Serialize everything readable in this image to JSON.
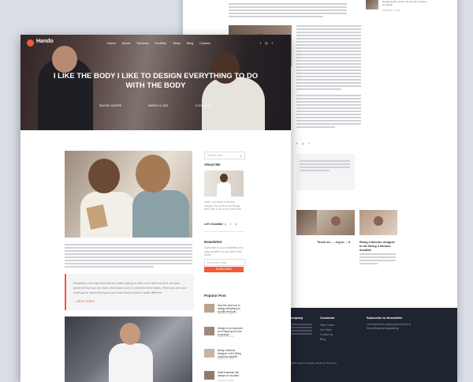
{
  "brand": {
    "name": "Hando",
    "accent": "#f15a3a"
  },
  "nav": {
    "items": [
      "Home",
      "About",
      "Services",
      "Portfolio",
      "Team",
      "Blog",
      "Contact"
    ]
  },
  "hero": {
    "title": "I LIKE THE BODY I LIKE TO DESIGN EVERYTHING TO DO WITH THE BODY",
    "meta": [
      "RACHEL MOORE",
      "MARCH 3, 2021",
      "3 COMMENTS"
    ]
  },
  "sidebar": {
    "search_placeholder": "Search here...",
    "about_title": "About Me",
    "about_text": "Hello, my name is Ashley Harper, my job is to do things that I like to do in my free time.",
    "connect_label": "Let's Socialize",
    "newsletter_title": "Newsletter",
    "newsletter_text": "Subscribe to our newsletter and stay updated on our offers and deals!",
    "email_placeholder": "Enter your email",
    "subscribe_label": "SUBSCRIBE",
    "popular_title": "Popular Post",
    "posts": [
      {
        "title": "How the plus how to design everything to do with the body",
        "date": "MARCH 3, 2021"
      },
      {
        "title": "Design is an important art of figuring out how to arrange",
        "date": "MARCH 3, 2021"
      },
      {
        "title": "Being a famous designer in the Being a famous doodlist",
        "date": "MARCH 3, 2021"
      },
      {
        "title": "Habit business hair always on my mind",
        "date": "MARCH 3, 2021"
      }
    ]
  },
  "quote": {
    "text": "Reading is not only informed by what's going on with us at that moment, but also governed by how our eyes and brains work to process information. What you see and what you're experiencing as you read these words is quite different.",
    "author": "— BRAD JONES"
  },
  "back": {
    "top_post_title": "Designing the need in the primary creative for design",
    "top_post_date": "FEBRUARY 3, 2021",
    "related": [
      {
        "title": "Touch on... ...ing to ... it",
        "date": "MARCH 3, 2021"
      },
      {
        "title": "Being a famous designer in the Being a famous doodlist",
        "date": "MARCH 3, 2021"
      }
    ]
  },
  "footer": {
    "col1_title": "Company",
    "col2_title": "Customer",
    "col2_links": [
      "Help Center",
      "Our Team",
      "Contact us",
      "Blog"
    ],
    "col3_title": "Subscribe to Newsletter",
    "col3_text": "Lorem ipsum is simply dummy text of the printing and typesetting",
    "email_placeholder": "Enter your email",
    "copyright": "© 2021 Hando | Template Made by ThemeGar"
  },
  "icons": [
    "facebook-icon",
    "instagram-icon",
    "twitter-icon",
    "pinterest-icon",
    "search-icon",
    "arrow-right-icon"
  ]
}
